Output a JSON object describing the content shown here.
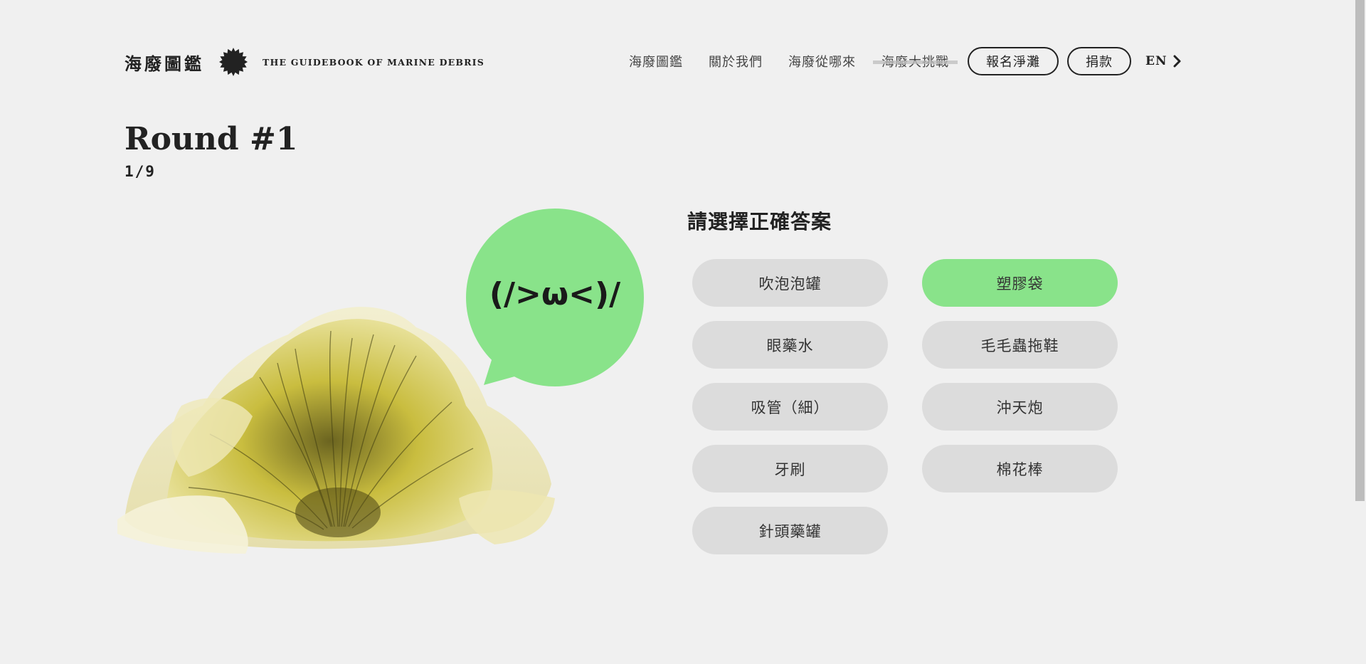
{
  "header": {
    "brand_title": "海廢圖鑑",
    "brand_subtitle": "THE GUIDEBOOK OF MARINE DEBRIS",
    "logo_icon": "spiky-sun-icon",
    "nav": [
      {
        "label": "海廢圖鑑"
      },
      {
        "label": "關於我們"
      },
      {
        "label": "海廢從哪來"
      },
      {
        "label": "海廢大挑戰"
      }
    ],
    "signup_button": "報名淨灘",
    "donate_button": "捐款",
    "lang_label": "EN",
    "lang_icon": "chevron-right-icon"
  },
  "round": {
    "title": "Round #1",
    "progress": "1/9"
  },
  "bubble": {
    "text": "(/>ω<)/",
    "color": "#89e38a"
  },
  "question": {
    "prompt": "請選擇正確答案",
    "answers": [
      {
        "label": "吹泡泡罐",
        "selected": false
      },
      {
        "label": "塑膠袋",
        "selected": true
      },
      {
        "label": "眼藥水",
        "selected": false
      },
      {
        "label": "毛毛蟲拖鞋",
        "selected": false
      },
      {
        "label": "吸管（細）",
        "selected": false
      },
      {
        "label": "沖天炮",
        "selected": false
      },
      {
        "label": "牙刷",
        "selected": false
      },
      {
        "label": "棉花棒",
        "selected": false
      },
      {
        "label": "針頭藥罐",
        "selected": false
      }
    ]
  },
  "colors": {
    "background": "#f0f0f0",
    "accent_green": "#89e38a",
    "answer_bg": "#dcdcdc",
    "text_dark": "#222222"
  }
}
